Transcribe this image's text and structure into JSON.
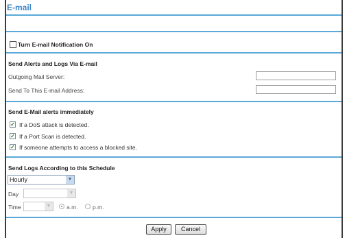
{
  "title": "E-mail",
  "notification": {
    "label": "Turn E-mail Notification On",
    "checked": false
  },
  "alerts_logs": {
    "heading": "Send Alerts and Logs Via E-mail",
    "outgoing_label": "Outgoing Mail Server:",
    "outgoing_value": "",
    "sendto_label": "Send To This E-mail Address:",
    "sendto_value": ""
  },
  "immediate": {
    "heading": "Send E-Mail alerts immediately",
    "items": [
      {
        "label": "If a DoS attack is detected.",
        "checked": true
      },
      {
        "label": "If a Port Scan is detected.",
        "checked": true
      },
      {
        "label": "If someone attempts to access a blocked site.",
        "checked": true
      }
    ]
  },
  "schedule": {
    "heading": "Send Logs According to this Schedule",
    "frequency": "Hourly",
    "day_label": "Day",
    "day_value": "",
    "time_label": "Time",
    "time_value": "",
    "am_label": "a.m.",
    "pm_label": "p.m.",
    "selected_period": "a.m."
  },
  "buttons": {
    "apply": "Apply",
    "cancel": "Cancel"
  },
  "colors": {
    "accent": "#3d86c4",
    "rule": "#5aa7d8"
  }
}
